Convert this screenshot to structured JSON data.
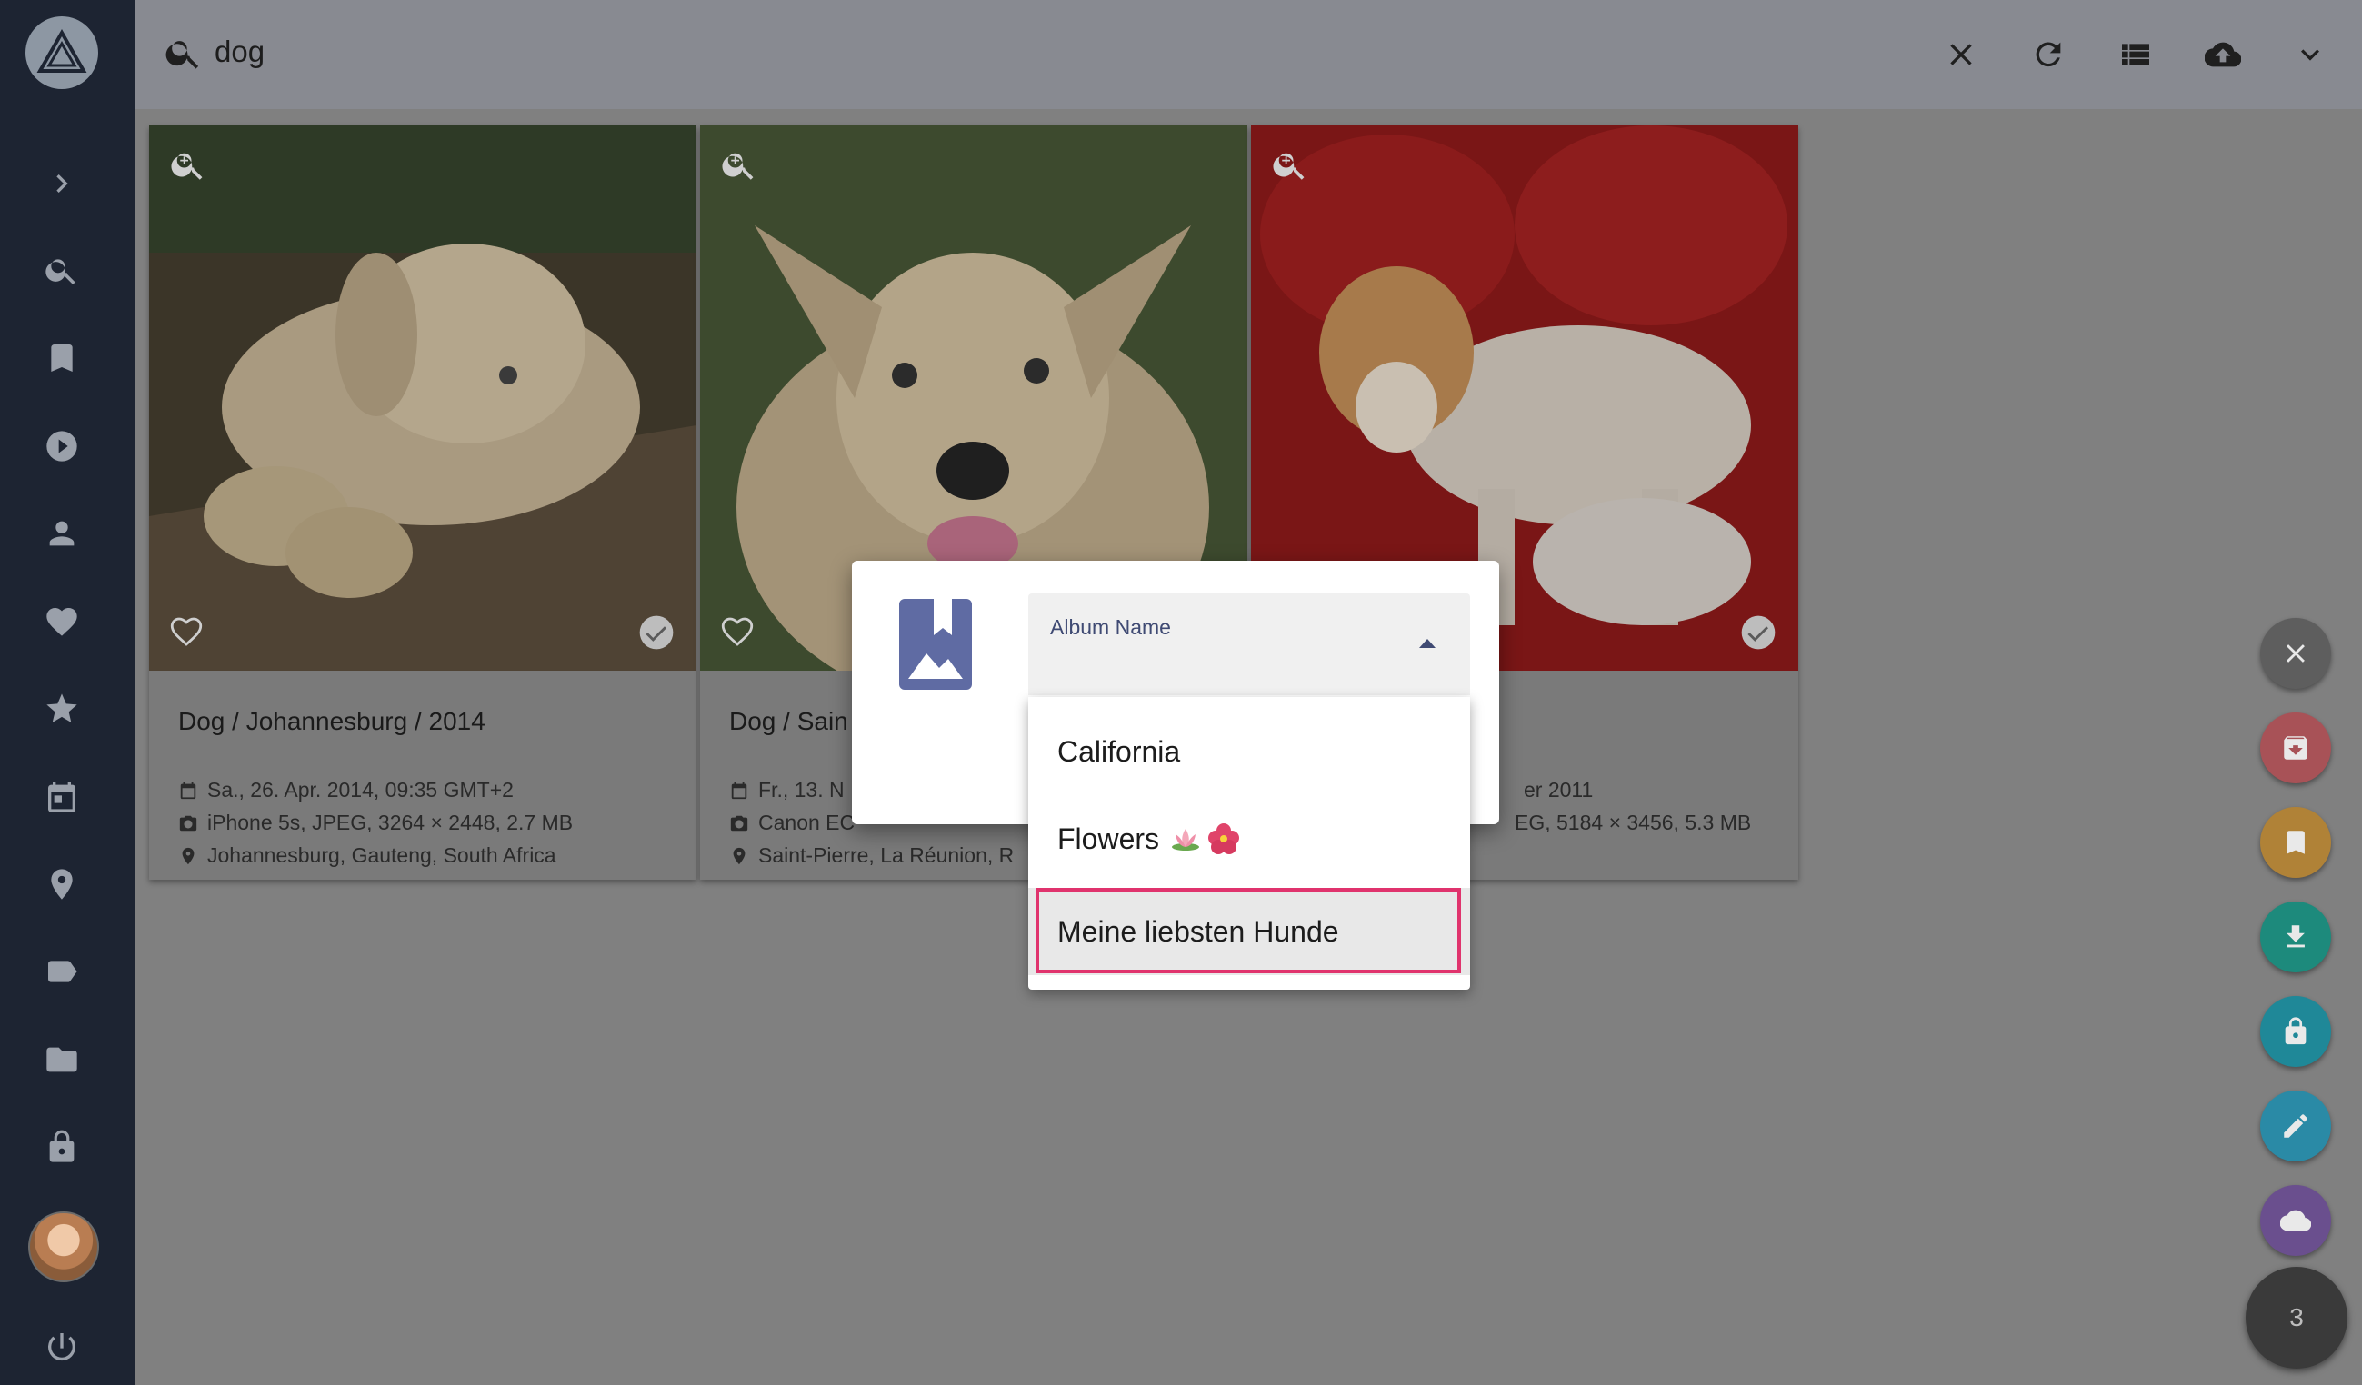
{
  "search": {
    "query": "dog"
  },
  "sidebar": {
    "items": [
      "expand",
      "search",
      "albums",
      "videos",
      "people",
      "favorites",
      "moments",
      "calendar",
      "places",
      "labels",
      "folders",
      "private",
      "avatar",
      "logout"
    ]
  },
  "toolbar": {
    "icons": [
      "clear-icon",
      "refresh-icon",
      "list-view-icon",
      "upload-icon",
      "expand-more-icon"
    ]
  },
  "cards": [
    {
      "title": "Dog / Johannesburg / 2014",
      "date": "Sa., 26. Apr. 2014, 09:35 GMT+2",
      "camera": "iPhone 5s, JPEG, 3264 × 2448, 2.7 MB",
      "location": "Johannesburg, Gauteng, South Africa"
    },
    {
      "title": "Dog / Sain",
      "date": "Fr., 13. N",
      "camera": "Canon EC",
      "location": "Saint-Pierre, La Réunion, R"
    },
    {
      "title": "",
      "date": "er 2011",
      "camera": "EG, 5184 × 3456, 5.3 MB",
      "location": ""
    }
  ],
  "dialog": {
    "field_label": "Album Name",
    "options": [
      "California",
      "Flowers",
      "Meine liebsten Hunde"
    ],
    "selected": "Meine liebsten Hunde"
  },
  "fabs": {
    "colors": [
      "#5e5e5e",
      "#a85257",
      "#b08237",
      "#1d8a7c",
      "#1f8898",
      "#2a8aa6",
      "#6a4f8e"
    ],
    "selection_count": "3"
  }
}
